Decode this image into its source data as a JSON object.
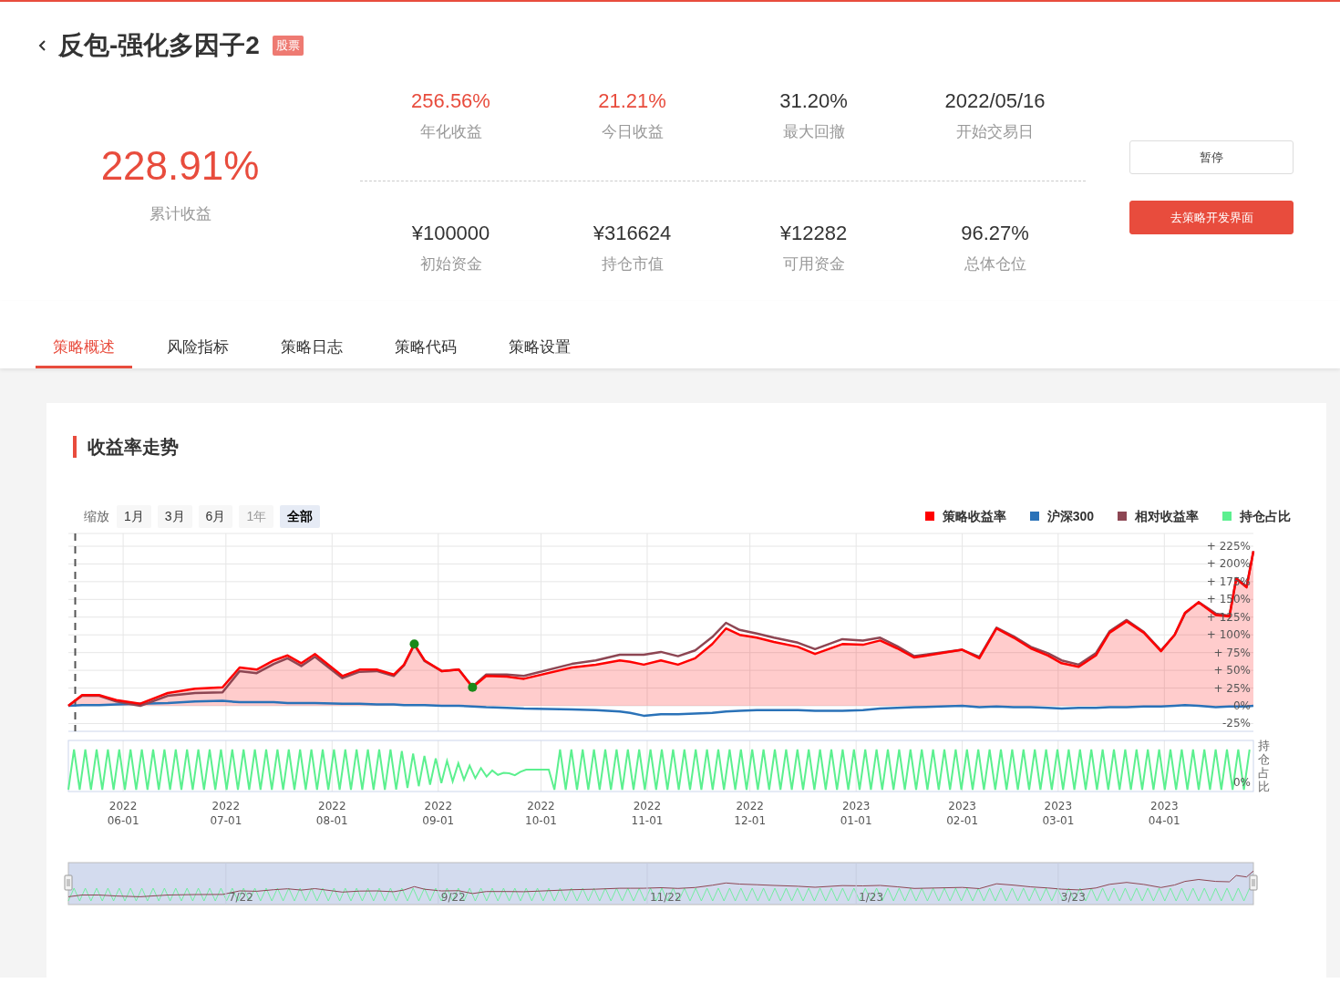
{
  "header": {
    "title": "反包-强化多因子2",
    "tag": "股票"
  },
  "total_return": {
    "value": "228.91%",
    "label": "累计收益"
  },
  "stats": [
    {
      "value": "256.56%",
      "label": "年化收益",
      "highlight": true
    },
    {
      "value": "21.21%",
      "label": "今日收益",
      "highlight": true
    },
    {
      "value": "31.20%",
      "label": "最大回撤",
      "highlight": false
    },
    {
      "value": "2022/05/16",
      "label": "开始交易日",
      "highlight": false
    },
    {
      "value": "¥100000",
      "label": "初始资金",
      "highlight": false
    },
    {
      "value": "¥316624",
      "label": "持仓市值",
      "highlight": false
    },
    {
      "value": "¥12282",
      "label": "可用资金",
      "highlight": false
    },
    {
      "value": "96.27%",
      "label": "总体仓位",
      "highlight": false
    }
  ],
  "buttons": [
    {
      "label": "暂停",
      "kind": "outline"
    },
    {
      "label": "去策略开发界面",
      "kind": "primary"
    }
  ],
  "tabs": [
    {
      "label": "策略概述",
      "selected": true
    },
    {
      "label": "风险指标",
      "selected": false
    },
    {
      "label": "策略日志",
      "selected": false
    },
    {
      "label": "策略代码",
      "selected": false
    },
    {
      "label": "策略设置",
      "selected": false
    }
  ],
  "section": {
    "title": "收益率走势"
  },
  "range_selector": {
    "label": "缩放",
    "options": [
      {
        "label": "1月",
        "selected": false,
        "disabled": false
      },
      {
        "label": "3月",
        "selected": false,
        "disabled": false
      },
      {
        "label": "6月",
        "selected": false,
        "disabled": false
      },
      {
        "label": "1年",
        "selected": false,
        "disabled": true
      },
      {
        "label": "全部",
        "selected": true,
        "disabled": false
      }
    ]
  },
  "chart_data": {
    "type": "line",
    "x": [
      "2022-05-16",
      "2022-05-20",
      "2022-05-25",
      "2022-05-30",
      "2022-06-06",
      "2022-06-14",
      "2022-06-22",
      "2022-06-30",
      "2022-07-05",
      "2022-07-10",
      "2022-07-15",
      "2022-07-19",
      "2022-07-23",
      "2022-07-27",
      "2022-08-04",
      "2022-08-09",
      "2022-08-14",
      "2022-08-19",
      "2022-08-22",
      "2022-08-25",
      "2022-08-28",
      "2022-09-02",
      "2022-09-07",
      "2022-09-11",
      "2022-09-15",
      "2022-09-21",
      "2022-09-26",
      "2022-10-10",
      "2022-10-17",
      "2022-10-24",
      "2022-10-27",
      "2022-10-31",
      "2022-11-05",
      "2022-11-10",
      "2022-11-15",
      "2022-11-20",
      "2022-11-24",
      "2022-11-28",
      "2022-12-03",
      "2022-12-08",
      "2022-12-15",
      "2022-12-20",
      "2022-12-28",
      "2023-01-03",
      "2023-01-08",
      "2023-01-13",
      "2023-01-18",
      "2023-02-01",
      "2023-02-06",
      "2023-02-11",
      "2023-02-16",
      "2023-02-21",
      "2023-02-26",
      "2023-03-02",
      "2023-03-07",
      "2023-03-12",
      "2023-03-16",
      "2023-03-21",
      "2023-03-26",
      "2023-03-31",
      "2023-04-04",
      "2023-04-07",
      "2023-04-11",
      "2023-04-16",
      "2023-04-20",
      "2023-04-22",
      "2023-04-25",
      "2023-04-27"
    ],
    "series": [
      {
        "name": "策略收益率",
        "color": "#ff0000",
        "values": [
          0,
          15,
          15,
          8,
          3,
          18,
          24,
          26,
          54,
          51,
          64,
          71,
          60,
          73,
          42,
          51,
          51,
          44,
          58,
          87,
          64,
          49,
          51,
          26,
          42,
          41,
          38,
          54,
          58,
          64,
          62,
          58,
          64,
          58,
          67,
          87,
          109,
          100,
          96,
          90,
          83,
          73,
          87,
          86,
          92,
          81,
          68,
          79,
          67,
          109,
          96,
          81,
          71,
          60,
          55,
          71,
          103,
          119,
          103,
          77,
          100,
          131,
          146,
          128,
          126,
          179,
          167,
          218
        ]
      },
      {
        "name": "沪深300",
        "color": "#2a72b8",
        "values": [
          0,
          1,
          1,
          2,
          3,
          4,
          6,
          7,
          5,
          5,
          5,
          4,
          4,
          4,
          3,
          3,
          2,
          2,
          1,
          1,
          1,
          0,
          0,
          -1,
          -2,
          -3,
          -4,
          -5,
          -6,
          -8,
          -10,
          -14,
          -12,
          -12,
          -11,
          -10,
          -8,
          -7,
          -6,
          -6,
          -6,
          -7,
          -7,
          -6,
          -4,
          -3,
          -2,
          0,
          -2,
          -1,
          -2,
          -2,
          -3,
          -4,
          -3,
          -3,
          -2,
          -2,
          -1,
          -1,
          0,
          1,
          0,
          -2,
          -1,
          -1,
          -1,
          0
        ]
      },
      {
        "name": "相对收益率",
        "color": "#8d4653",
        "values": [
          0,
          14,
          14,
          6,
          0,
          14,
          18,
          19,
          49,
          46,
          59,
          67,
          56,
          69,
          39,
          48,
          49,
          42,
          57,
          86,
          63,
          49,
          51,
          27,
          44,
          44,
          42,
          59,
          64,
          72,
          72,
          72,
          76,
          70,
          78,
          97,
          117,
          107,
          102,
          96,
          89,
          80,
          94,
          92,
          96,
          84,
          70,
          79,
          69,
          110,
          98,
          83,
          74,
          64,
          58,
          74,
          105,
          121,
          104,
          78,
          100,
          130,
          146,
          130,
          127,
          180,
          168,
          218
        ]
      }
    ],
    "xlim": [
      "2022-05-16",
      "2023-04-27"
    ],
    "ylim": [
      -36,
      243
    ],
    "xticks": [
      {
        "value": "2022-06-01",
        "label": "2022 06-01"
      },
      {
        "value": "2022-07-01",
        "label": "2022 07-01"
      },
      {
        "value": "2022-08-01",
        "label": "2022 08-01"
      },
      {
        "value": "2022-09-01",
        "label": "2022 09-01"
      },
      {
        "value": "2022-10-01",
        "label": "2022 10-01"
      },
      {
        "value": "2022-11-01",
        "label": "2022 11-01"
      },
      {
        "value": "2022-12-01",
        "label": "2022 12-01"
      },
      {
        "value": "2023-01-01",
        "label": "2023 01-01"
      },
      {
        "value": "2023-02-01",
        "label": "2023 02-01"
      },
      {
        "value": "2023-03-01",
        "label": "2023 03-01"
      },
      {
        "value": "2023-04-01",
        "label": "2023 04-01"
      }
    ],
    "yticks": [
      {
        "value": 225,
        "label": "+ 225%"
      },
      {
        "value": 200,
        "label": "+ 200%"
      },
      {
        "value": 175,
        "label": "+ 175%"
      },
      {
        "value": 150,
        "label": "+ 150%"
      },
      {
        "value": 125,
        "label": "+ 125%"
      },
      {
        "value": 100,
        "label": "+ 100%"
      },
      {
        "value": 75,
        "label": "+ 75%"
      },
      {
        "value": 50,
        "label": "+ 50%"
      },
      {
        "value": 25,
        "label": "+ 25%"
      },
      {
        "value": 0,
        "label": "0%"
      },
      {
        "value": -25,
        "label": "-25%"
      }
    ],
    "grid": true,
    "ref_lines": [
      {
        "axis": "x",
        "value": "2022-05-18"
      }
    ]
  },
  "position_pane": {
    "name": "持仓占比",
    "color": "#5cf08f",
    "axis_title": "持仓占比",
    "tick": "0%"
  },
  "navigator": {
    "labels": [
      "7/22",
      "9/22",
      "11/22",
      "1/23",
      "3/23"
    ]
  }
}
